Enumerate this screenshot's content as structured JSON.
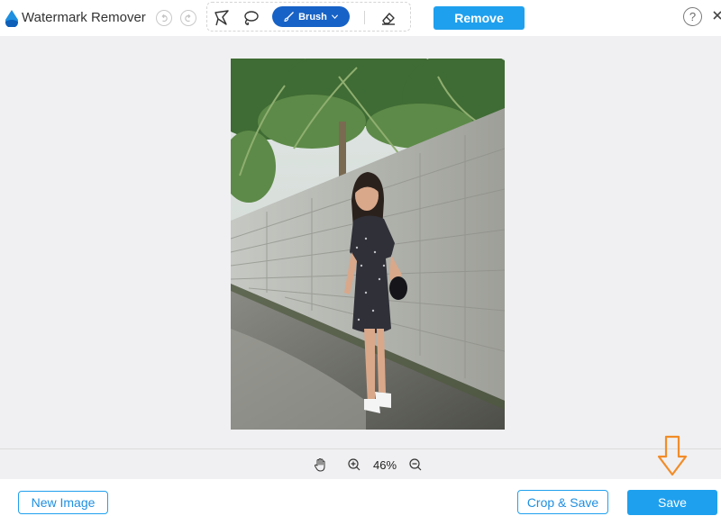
{
  "app": {
    "title": "Watermark Remover"
  },
  "toolbar": {
    "undo_icon": "undo-icon",
    "redo_icon": "redo-icon",
    "polygonal_lasso_icon": "polygonal-lasso-icon",
    "lasso_icon": "lasso-icon",
    "brush_label": "Brush",
    "eraser_icon": "eraser-icon",
    "remove_label": "Remove",
    "help_label": "?",
    "close_icon": "close-icon"
  },
  "zoom": {
    "level": "46%",
    "hand_icon": "hand-icon",
    "zoom_in_icon": "zoom-in-icon",
    "zoom_out_icon": "zoom-out-icon"
  },
  "footer": {
    "new_image_label": "New Image",
    "crop_save_label": "Crop & Save",
    "save_label": "Save"
  },
  "colors": {
    "accent": "#1fa0ee",
    "brush_active": "#1762c6",
    "canvas_bg": "#f0f0f2",
    "arrow": "#f28c28"
  }
}
